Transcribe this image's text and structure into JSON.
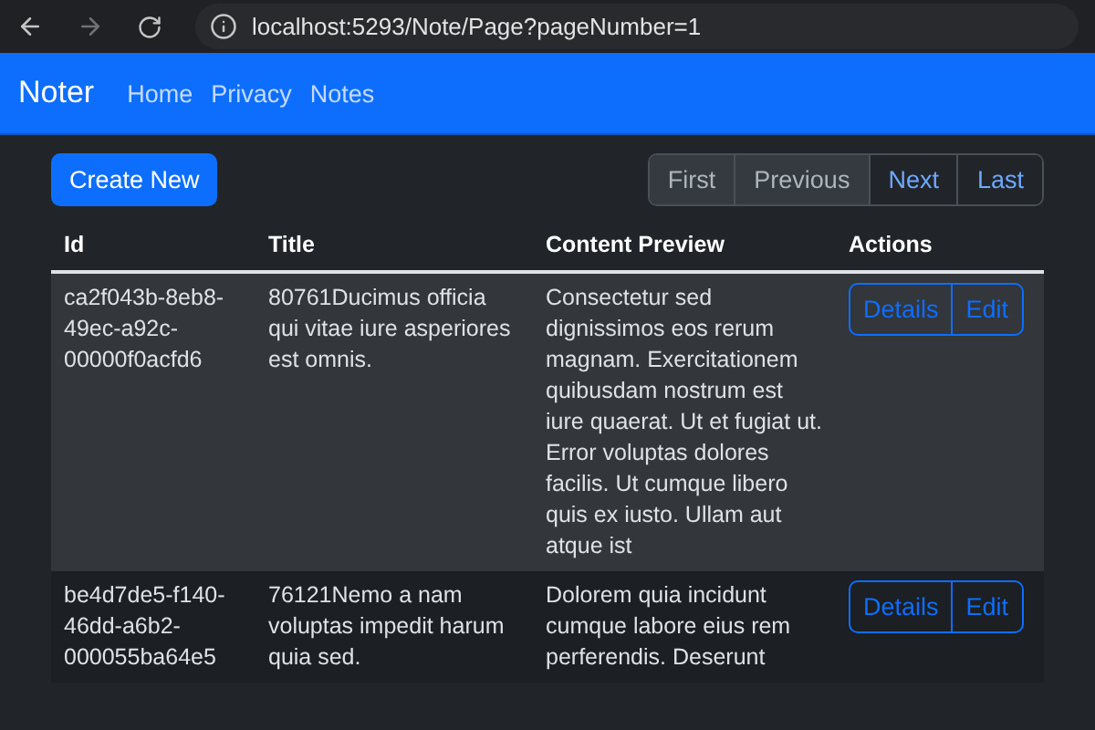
{
  "browser": {
    "url": "localhost:5293/Note/Page?pageNumber=1"
  },
  "navbar": {
    "brand": "Noter",
    "links": [
      "Home",
      "Privacy",
      "Notes"
    ]
  },
  "create_button": "Create New",
  "pagination": [
    {
      "label": "First",
      "disabled": true
    },
    {
      "label": "Previous",
      "disabled": true
    },
    {
      "label": "Next",
      "disabled": false
    },
    {
      "label": "Last",
      "disabled": false
    }
  ],
  "table": {
    "columns": [
      "Id",
      "Title",
      "Content Preview",
      "Actions"
    ],
    "rows": [
      {
        "id": "ca2f043b-8eb8-49ec-a92c-00000f0acfd6",
        "title": "80761Ducimus officia qui vitae iure asperiores est omnis.",
        "content": "Consectetur sed dignissimos eos rerum magnam. Exercitationem quibusdam nostrum est iure quaerat. Ut et fugiat ut. Error voluptas dolores facilis. Ut cumque libero quis ex iusto. Ullam aut atque ist",
        "highlighted": true,
        "actions": [
          "Details",
          "Edit"
        ]
      },
      {
        "id": "be4d7de5-f140-46dd-a6b2-000055ba64e5",
        "title": "76121Nemo a nam voluptas impedit harum quia sed.",
        "content": "Dolorem quia incidunt cumque labore eius rem perferendis. Deserunt",
        "highlighted": false,
        "actions": [
          "Details",
          "Edit"
        ]
      }
    ]
  }
}
